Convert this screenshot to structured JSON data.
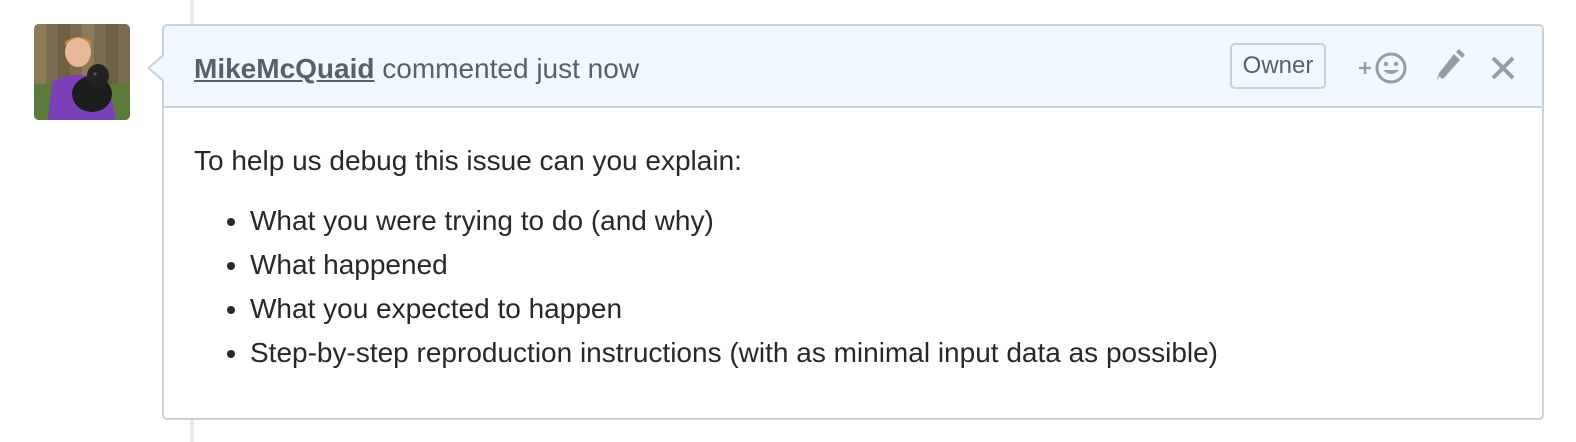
{
  "comment": {
    "author": "MikeMcQuaid",
    "action_text": "commented just now",
    "role_badge": "Owner",
    "actions": {
      "reaction_icon": "add-reaction-icon",
      "edit_icon": "pencil-icon",
      "delete_icon": "close-icon"
    },
    "body": {
      "intro": "To help us debug this issue can you explain:",
      "items": [
        "What you were trying to do (and why)",
        "What happened",
        "What you expected to happen",
        "Step-by-step reproduction instructions (with as minimal input data as possible)"
      ]
    }
  },
  "colors": {
    "header_bg": "#f1f8ff",
    "border": "#c8d1d9",
    "muted_text": "#586069",
    "body_text": "#24292e",
    "icon": "#959da5"
  }
}
